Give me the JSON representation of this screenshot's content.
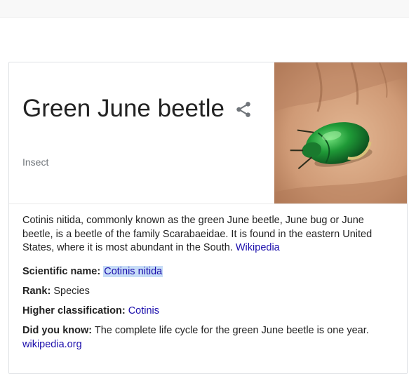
{
  "entity": {
    "title": "Green June beetle",
    "subtitle": "Insect"
  },
  "icons": {
    "share": "share-icon"
  },
  "description": {
    "text": "Cotinis nitida, commonly known as the green June beetle, June bug or June beetle, is a beetle of the family Scarabaeidae. It is found in the eastern United States, where it is most abundant in the South.",
    "source_link": "Wikipedia"
  },
  "facts": {
    "scientific_name": {
      "label": "Scientific name:",
      "value": "Cotinis nitida"
    },
    "rank": {
      "label": "Rank:",
      "value": "Species"
    },
    "higher_classification": {
      "label": "Higher classification:",
      "value": "Cotinis"
    },
    "did_you_know": {
      "label": "Did you know:",
      "text": "The complete life cycle for the green June beetle is one year.",
      "link": "wikipedia.org"
    }
  },
  "colors": {
    "link": "#1a0dab",
    "highlight": "#c6dcf7",
    "subtitle": "#70757a"
  }
}
